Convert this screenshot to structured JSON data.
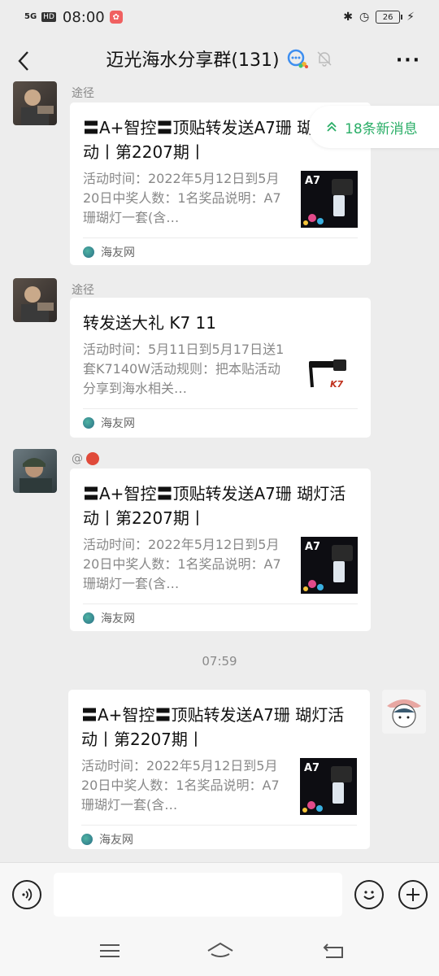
{
  "status_bar": {
    "signal": "5G",
    "hd": "HD",
    "time": "08:00",
    "battery": "26"
  },
  "header": {
    "back_icon": "chevron-left-icon",
    "title": "迈光海水分享群(131)",
    "more_icon": "more-dots-icon"
  },
  "new_messages": {
    "label": "18条新消息",
    "color": "#2aae67"
  },
  "messages": [
    {
      "sender": "途径",
      "title": "〓A+智控〓顶贴转发送A7珊 瑚灯活动丨第2207期丨",
      "desc": "活动时间：2022年5月12日到5月20日中奖人数：1名奖品说明：A7珊瑚灯一套(含…",
      "source": "海友网",
      "thumb_label": "A7"
    },
    {
      "sender": "途径",
      "title": "转发送大礼 K7 11",
      "desc": "活动时间：5月11日到5月17日送1套K7140W活动规则：把本贴活动分享到海水相关…",
      "source": "海友网",
      "thumb_label": "K7"
    },
    {
      "sender": "@",
      "title": "〓A+智控〓顶贴转发送A7珊 瑚灯活动丨第2207期丨",
      "desc": "活动时间：2022年5月12日到5月20日中奖人数：1名奖品说明：A7珊瑚灯一套(含…",
      "source": "海友网",
      "thumb_label": "A7"
    },
    {
      "sender": "",
      "title": "〓A+智控〓顶贴转发送A7珊 瑚灯活动丨第2207期丨",
      "desc": "活动时间：2022年5月12日到5月20日中奖人数：1名奖品说明：A7珊瑚灯一套(含…",
      "source": "海友网",
      "thumb_label": "A7"
    }
  ],
  "time_divider": "07:59",
  "input_bar": {
    "placeholder": ""
  }
}
